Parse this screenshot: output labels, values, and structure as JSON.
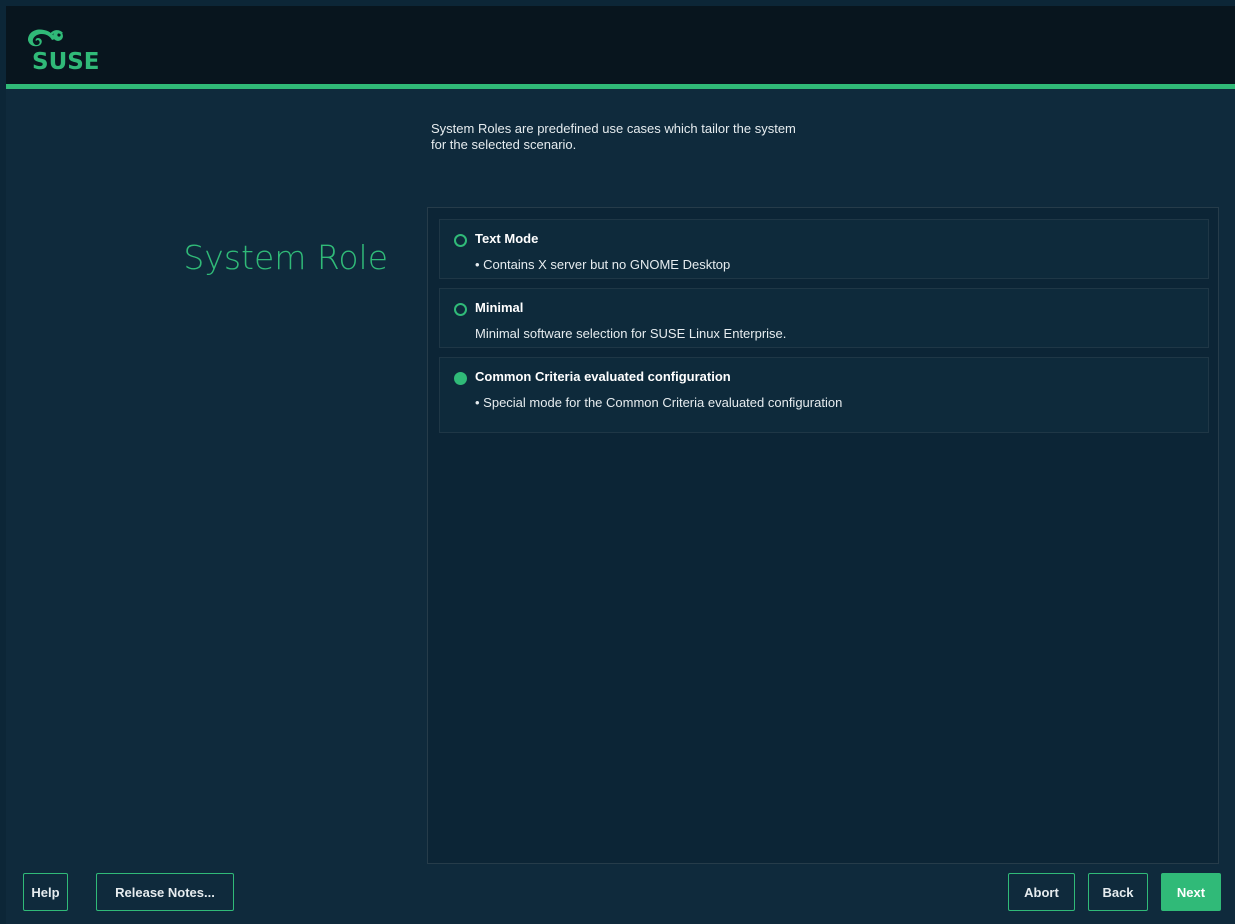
{
  "header": {
    "logo_text": "SUSE"
  },
  "page": {
    "title": "System Role",
    "description_line1": "System Roles are predefined use cases which tailor the system",
    "description_line2": "for the selected scenario."
  },
  "roles": [
    {
      "label": "Text Mode",
      "description": "• Contains X server but no GNOME Desktop",
      "selected": false
    },
    {
      "label": "Minimal",
      "description": "Minimal software selection for SUSE Linux Enterprise.",
      "selected": false
    },
    {
      "label": "Common Criteria evaluated configuration",
      "description": "• Special mode for the Common Criteria evaluated configuration",
      "selected": true
    }
  ],
  "buttons": {
    "help": "Help",
    "release_notes": "Release Notes...",
    "abort": "Abort",
    "back": "Back",
    "next": "Next"
  },
  "colors": {
    "accent": "#30ba78",
    "header_bg": "#08151e",
    "main_bg": "#0f2a3c"
  }
}
